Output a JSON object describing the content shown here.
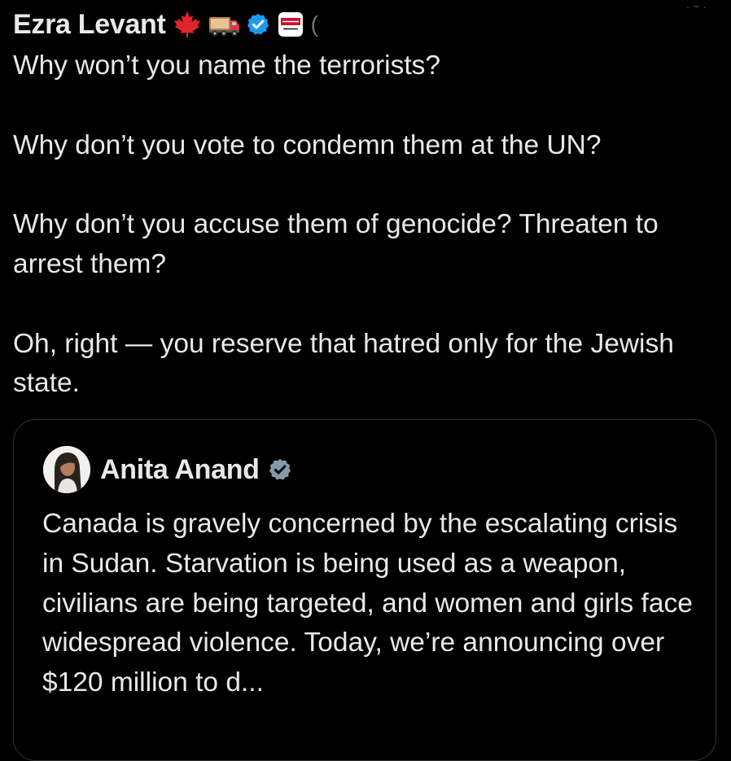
{
  "tweet": {
    "author": {
      "name": "Ezra Levant",
      "badges": [
        "maple-leaf-emoji",
        "truck-emoji",
        "verified-badge",
        "rebel-news-logo"
      ],
      "truncated_suffix": "("
    },
    "paragraphs": [
      "Why won’t you name the terrorists?",
      "Why don’t you vote to condemn them at the UN?",
      "Why don’t you accuse them of genocide? Threaten to arrest them?",
      "Oh, right — you reserve that hatred only for the Jewish state."
    ]
  },
  "quoted_tweet": {
    "author": {
      "name": "Anita Anand",
      "badge": "government-verified-badge"
    },
    "text": "Canada is gravely concerned by the escalating crisis in Sudan. Starvation is being used as a weapon, civilians are being targeted, and women and girls face widespread violence. Today, we’re announcing over $120 million to d..."
  },
  "colors": {
    "background": "#000000",
    "text_primary": "#e7e9ea",
    "text_secondary": "#71767b",
    "border": "#2f3336",
    "verified_blue": "#1d9bf0",
    "gov_gray": "#829aab",
    "maple_red": "#e0242c"
  }
}
